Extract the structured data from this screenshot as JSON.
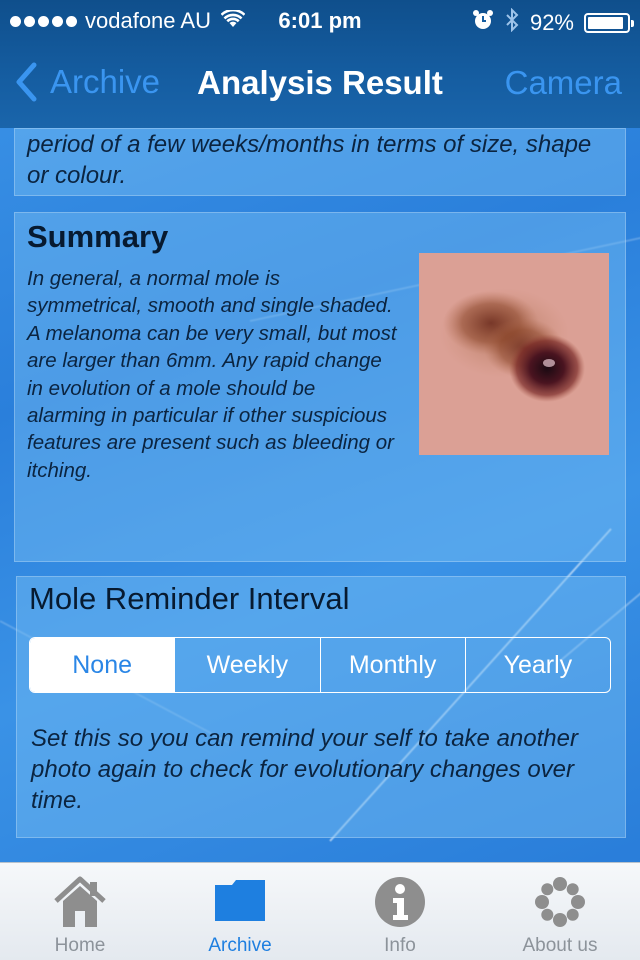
{
  "status_bar": {
    "carrier": "vodafone AU",
    "time": "6:01 pm",
    "battery_percent": "92%",
    "battery_level": 0.92,
    "icons": [
      "signal-dots-icon",
      "wifi-icon",
      "alarm-icon",
      "bluetooth-icon",
      "battery-icon"
    ]
  },
  "nav": {
    "back_label": "Archive",
    "title": "Analysis Result",
    "right_label": "Camera"
  },
  "top_panel": {
    "text": "period of a few weeks/months in terms of size, shape or colour."
  },
  "summary": {
    "heading": "Summary",
    "body": "In general, a normal mole is symmetrical, smooth and single shaded. A melanoma can be very small, but most are larger than 6mm. Any rapid change in evolution of a mole should be alarming in particular if other suspicious features are present such as bleeding or itching."
  },
  "reminder": {
    "heading": "Mole Reminder Interval",
    "options": [
      "None",
      "Weekly",
      "Monthly",
      "Yearly"
    ],
    "selected": "None",
    "note": "Set this so you can remind your self to take another photo again to check for evolutionary changes over time."
  },
  "tabbar": {
    "tabs": [
      {
        "label": "Home",
        "icon": "home-icon"
      },
      {
        "label": "Archive",
        "icon": "folder-icon"
      },
      {
        "label": "Info",
        "icon": "info-icon"
      },
      {
        "label": "About us",
        "icon": "gear-flower-icon"
      }
    ],
    "active": "Archive"
  },
  "colors": {
    "accent": "#3a95f0",
    "tab_active": "#1e7fe0",
    "tab_inactive": "#8c939a",
    "nav_bar": "#155da1"
  }
}
